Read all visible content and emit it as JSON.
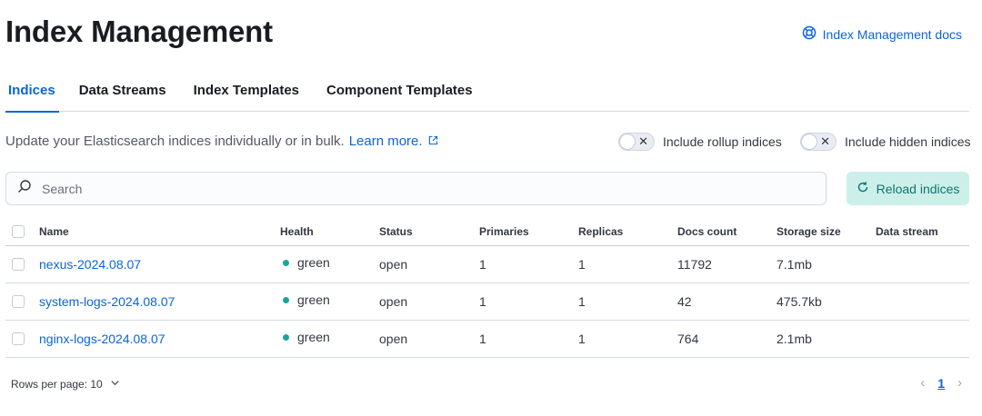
{
  "header": {
    "title": "Index Management",
    "docs_link": "Index Management docs"
  },
  "tabs": [
    {
      "label": "Indices",
      "active": true
    },
    {
      "label": "Data Streams",
      "active": false
    },
    {
      "label": "Index Templates",
      "active": false
    },
    {
      "label": "Component Templates",
      "active": false
    }
  ],
  "description": {
    "text": "Update your Elasticsearch indices individually or in bulk.",
    "link": "Learn more."
  },
  "toggles": {
    "rollup": {
      "label": "Include rollup indices",
      "on": false
    },
    "hidden": {
      "label": "Include hidden indices",
      "on": false
    }
  },
  "search": {
    "placeholder": "Search",
    "value": ""
  },
  "reload_button": "Reload indices",
  "table": {
    "columns": [
      "Name",
      "Health",
      "Status",
      "Primaries",
      "Replicas",
      "Docs count",
      "Storage size",
      "Data stream"
    ],
    "rows": [
      {
        "name": "nexus-2024.08.07",
        "health": "green",
        "status": "open",
        "primaries": "1",
        "replicas": "1",
        "docs_count": "11792",
        "storage_size": "7.1mb",
        "data_stream": ""
      },
      {
        "name": "system-logs-2024.08.07",
        "health": "green",
        "status": "open",
        "primaries": "1",
        "replicas": "1",
        "docs_count": "42",
        "storage_size": "475.7kb",
        "data_stream": ""
      },
      {
        "name": "nginx-logs-2024.08.07",
        "health": "green",
        "status": "open",
        "primaries": "1",
        "replicas": "1",
        "docs_count": "764",
        "storage_size": "2.1mb",
        "data_stream": ""
      }
    ]
  },
  "footer": {
    "rows_per_page": "Rows per page: 10",
    "current_page": "1"
  },
  "colors": {
    "accent": "#0b64dd",
    "health_green": "#1ea59a",
    "reload_bg": "#cdefea",
    "reload_text": "#0f766e"
  },
  "icons": {
    "docs": "help-lifebuoy-icon",
    "external": "external-link-icon",
    "search": "search-icon",
    "reload": "refresh-icon",
    "rows_menu": "chevron-down-icon",
    "prev": "chevron-left-icon",
    "next": "chevron-right-icon"
  }
}
